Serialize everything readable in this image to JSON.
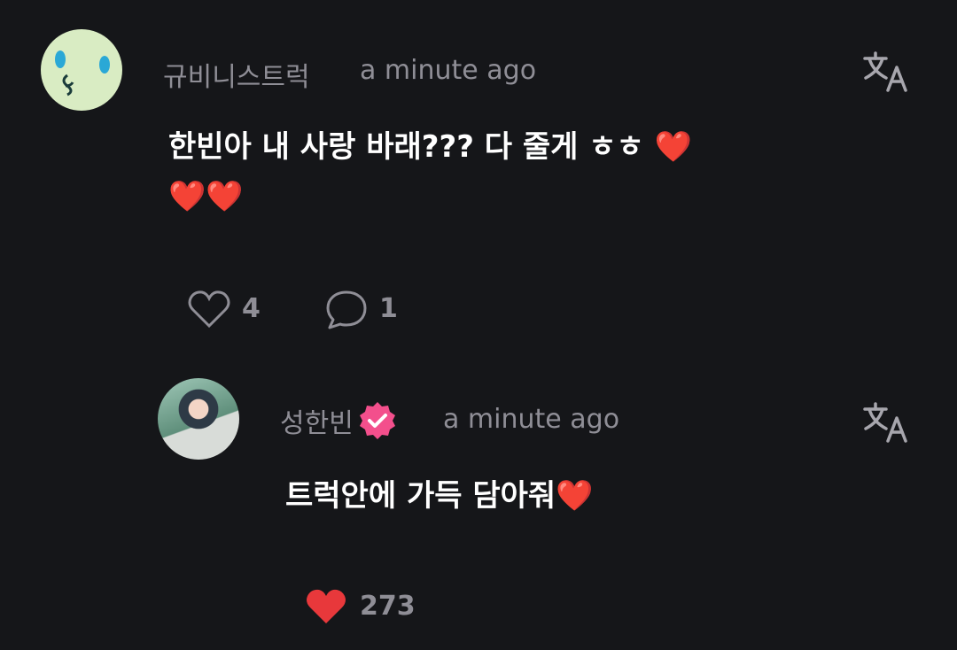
{
  "comment": {
    "username": "규비니스트럭",
    "time": "a minute ago",
    "text_line1": "한빈아 내 사랑 바래??? 다 줄게 ㅎㅎ ❤️",
    "text_line2": "❤️❤️",
    "likes": "4",
    "replies": "1",
    "avatar_icon": "cartoon-face-avatar",
    "translate_icon": "translate-icon"
  },
  "reply": {
    "username": "성한빈",
    "time": "a minute ago",
    "text": "트럭안에 가득 담아줘❤️",
    "likes": "273",
    "verified_icon": "verified-badge-icon",
    "translate_icon": "translate-icon"
  },
  "colors": {
    "background": "#151619",
    "muted_text": "#8f8e96",
    "heart": "#e8383b",
    "verified_badge": "#f34f8c"
  }
}
